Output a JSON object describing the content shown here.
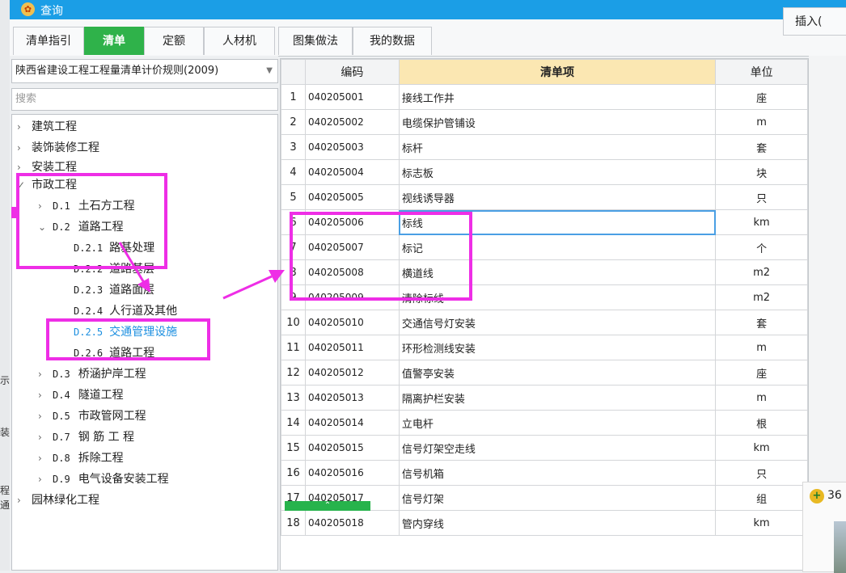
{
  "window": {
    "title": "查询",
    "logo_glyph": "✿"
  },
  "tabs": [
    {
      "label": "清单指引",
      "active": false
    },
    {
      "label": "清单",
      "active": true
    },
    {
      "label": "定额",
      "active": false
    },
    {
      "label": "人材机",
      "active": false
    },
    {
      "label": "图集做法",
      "active": false
    },
    {
      "label": "我的数据",
      "active": false
    }
  ],
  "toolbar": {
    "insert_label": "插入("
  },
  "left_panel": {
    "rule_select": "陕西省建设工程工程量清单计价规则(2009)",
    "search_placeholder": "搜索",
    "tree": [
      {
        "label": "建筑工程",
        "expanded": false
      },
      {
        "label": "装饰装修工程",
        "expanded": false
      },
      {
        "label": "安装工程",
        "expanded": false
      },
      {
        "label": "市政工程",
        "expanded": true
      },
      {
        "code": "D.1",
        "label": "土石方工程",
        "expanded": false
      },
      {
        "code": "D.2",
        "label": "道路工程",
        "expanded": true
      },
      {
        "code": "D.2.1",
        "label": "路基处理"
      },
      {
        "code": "D.2.2",
        "label": "道路基层"
      },
      {
        "code": "D.2.3",
        "label": "道路面层"
      },
      {
        "code": "D.2.4",
        "label": "人行道及其他"
      },
      {
        "code": "D.2.5",
        "label": "交通管理设施",
        "selected": true
      },
      {
        "code": "D.2.6",
        "label": "道路工程"
      },
      {
        "code": "D.3",
        "label": "桥涵护岸工程",
        "expanded": false
      },
      {
        "code": "D.4",
        "label": "隧道工程",
        "expanded": false
      },
      {
        "code": "D.5",
        "label": "市政管网工程",
        "expanded": false
      },
      {
        "code": "D.7",
        "label": "钢 筋 工 程",
        "expanded": false
      },
      {
        "code": "D.8",
        "label": "拆除工程",
        "expanded": false
      },
      {
        "code": "D.9",
        "label": "电气设备安装工程",
        "expanded": false
      },
      {
        "label": "园林绿化工程",
        "expanded": false
      }
    ]
  },
  "table": {
    "headers": {
      "row_no": "",
      "code": "编码",
      "item": "清单项",
      "unit": "单位"
    },
    "selected_row": 6,
    "rows": [
      {
        "no": "1",
        "code": "040205001",
        "item": "接线工作井",
        "unit": "座"
      },
      {
        "no": "2",
        "code": "040205002",
        "item": "电缆保护管铺设",
        "unit": "m"
      },
      {
        "no": "3",
        "code": "040205003",
        "item": "标杆",
        "unit": "套"
      },
      {
        "no": "4",
        "code": "040205004",
        "item": "标志板",
        "unit": "块"
      },
      {
        "no": "5",
        "code": "040205005",
        "item": "视线诱导器",
        "unit": "只"
      },
      {
        "no": "6",
        "code": "040205006",
        "item": "标线",
        "unit": "km"
      },
      {
        "no": "7",
        "code": "040205007",
        "item": "标记",
        "unit": "个"
      },
      {
        "no": "8",
        "code": "040205008",
        "item": "横道线",
        "unit": "m2"
      },
      {
        "no": "9",
        "code": "040205009",
        "item": "清除标线",
        "unit": "m2"
      },
      {
        "no": "10",
        "code": "040205010",
        "item": "交通信号灯安装",
        "unit": "套"
      },
      {
        "no": "11",
        "code": "040205011",
        "item": "环形检测线安装",
        "unit": "m"
      },
      {
        "no": "12",
        "code": "040205012",
        "item": "值警亭安装",
        "unit": "座"
      },
      {
        "no": "13",
        "code": "040205013",
        "item": "隔离护栏安装",
        "unit": "m"
      },
      {
        "no": "14",
        "code": "040205014",
        "item": "立电杆",
        "unit": "根"
      },
      {
        "no": "15",
        "code": "040205015",
        "item": "信号灯架空走线",
        "unit": "km"
      },
      {
        "no": "16",
        "code": "040205016",
        "item": "信号机箱",
        "unit": "只"
      },
      {
        "no": "17",
        "code": "040205017",
        "item": "信号灯架",
        "unit": "组"
      },
      {
        "no": "18",
        "code": "040205018",
        "item": "管内穿线",
        "unit": "km"
      }
    ]
  },
  "left_edge_fragments": [
    "示",
    "装",
    "程",
    "通"
  ],
  "popup": {
    "text": "36"
  },
  "colors": {
    "title_bar": "#1b9ee6",
    "active_tab": "#2fb24a",
    "annotation": "#ee2ee6",
    "selection": "#1c8fe0"
  }
}
